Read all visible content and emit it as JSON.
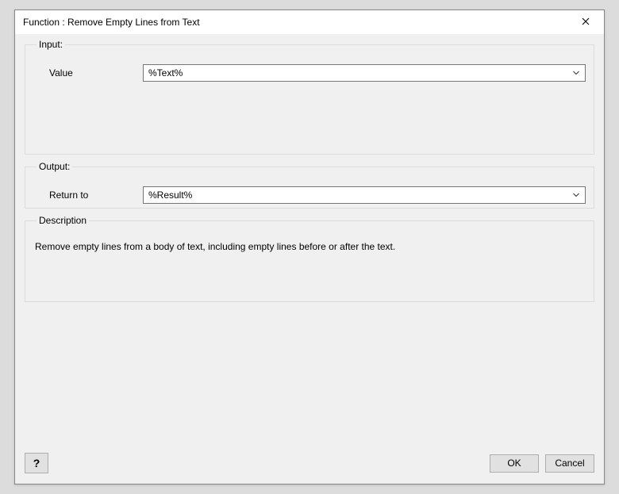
{
  "titlebar": {
    "title": "Function : Remove Empty Lines from Text"
  },
  "groups": {
    "input": {
      "legend": "Input:",
      "value_label": "Value",
      "value": "%Text%"
    },
    "output": {
      "legend": "Output:",
      "return_label": "Return to",
      "value": "%Result%"
    },
    "description": {
      "legend": "Description",
      "text": "Remove empty lines from a body of text, including empty lines before or after the text."
    }
  },
  "footer": {
    "help": "?",
    "ok": "OK",
    "cancel": "Cancel"
  }
}
